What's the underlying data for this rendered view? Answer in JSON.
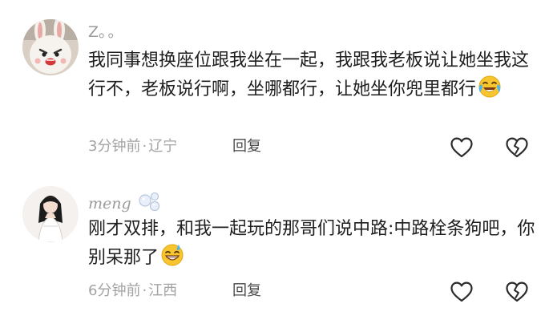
{
  "comments": [
    {
      "username": "Z",
      "username_suffix": "。。",
      "text": "我同事想换座位跟我坐在一起，我跟我老板说让她坐我这行不，老板说行啊，坐哪都行，让她坐你兜里都行",
      "emoji": "laughing-crying-emoji",
      "time": "3分钟前",
      "separator": "·",
      "location": "辽宁",
      "reply_label": "回复"
    },
    {
      "username": "meng",
      "username_badge": "bubble-badge",
      "text": "刚才双排，和我一起玩的那哥们说中路:中路栓条狗吧，你别呆那了",
      "emoji": "sweat-grin-emoji",
      "time": "6分钟前",
      "separator": "·",
      "location": "江西",
      "reply_label": "回复"
    }
  ],
  "icons": {
    "like": "heart-outline-icon",
    "dislike": "broken-heart-outline-icon"
  },
  "colors": {
    "text": "#1f1f1f",
    "meta": "#a3a3a3",
    "username": "#9b9b9b",
    "reply": "#4a4a4a",
    "icon_stroke": "#2b2b2b"
  }
}
